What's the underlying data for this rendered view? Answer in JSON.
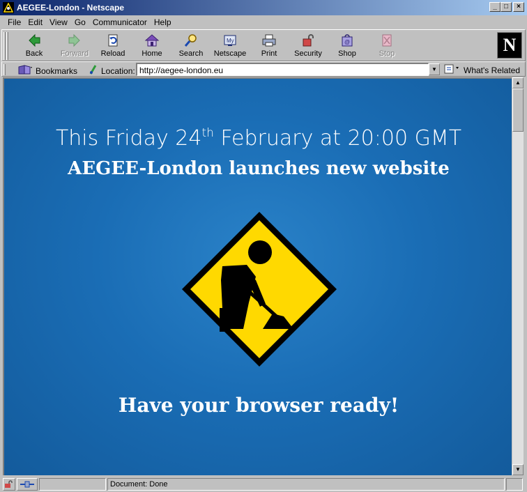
{
  "window": {
    "title": "AEGEE-London - Netscape",
    "controls": [
      "minimize",
      "maximize",
      "close"
    ]
  },
  "menu": [
    "File",
    "Edit",
    "View",
    "Go",
    "Communicator",
    "Help"
  ],
  "toolbar": [
    {
      "label": "Back",
      "icon": "back-arrow-icon",
      "enabled": true
    },
    {
      "label": "Forward",
      "icon": "forward-arrow-icon",
      "enabled": false
    },
    {
      "label": "Reload",
      "icon": "reload-icon",
      "enabled": true
    },
    {
      "label": "Home",
      "icon": "home-icon",
      "enabled": true
    },
    {
      "label": "Search",
      "icon": "search-icon",
      "enabled": true
    },
    {
      "label": "Netscape",
      "icon": "my-netscape-icon",
      "enabled": true
    },
    {
      "label": "Print",
      "icon": "printer-icon",
      "enabled": true
    },
    {
      "label": "Security",
      "icon": "lock-icon",
      "enabled": true
    },
    {
      "label": "Shop",
      "icon": "shop-bag-icon",
      "enabled": true
    },
    {
      "label": "Stop",
      "icon": "stop-icon",
      "enabled": false
    }
  ],
  "location": {
    "bookmarks_label": "Bookmarks",
    "label": "Location:",
    "url": "http://aegee-london.eu",
    "related_label": "What's Related"
  },
  "content": {
    "line1_before": "This Friday 24",
    "line1_sup": "th",
    "line1_after": " February at 20:00 GMT",
    "line2": "AEGEE-London launches new website",
    "line3": "Have your browser ready!",
    "sign_icon": "under-construction-sign-icon",
    "colors": {
      "background": "#1a6db5",
      "sign_yellow": "#ffd900",
      "sign_black": "#000000",
      "text": "#ffffff"
    }
  },
  "status": {
    "text": "Document: Done"
  }
}
